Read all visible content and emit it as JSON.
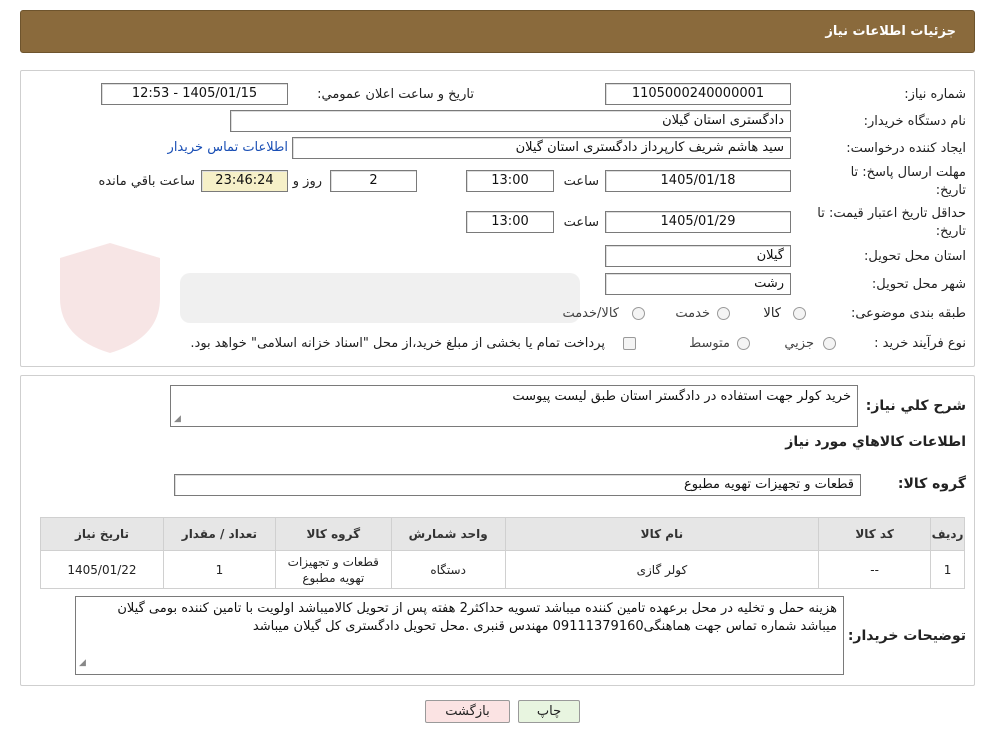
{
  "header": {
    "title": "جزئیات اطلاعات نیاز"
  },
  "form": {
    "need_number_label": "شماره نیاز:",
    "need_number": "1105000240000001",
    "announce_label": "تاریخ و ساعت اعلان عمومي:",
    "announce_value": "1405/01/15 - 12:53",
    "buyer_org_label": "نام دستگاه خريدار:",
    "buyer_org": "دادگستری استان گیلان",
    "creator_label": "ايجاد کننده درخواست:",
    "creator": "سید هاشم شریف کارپرداز دادگستری استان گیلان",
    "contact_link": "اطلاعات تماس خريدار",
    "deadline_label_1": "مهلت ارسال پاسخ: تا",
    "deadline_label_2": "تاريخ:",
    "deadline_date": "1405/01/18",
    "time_label": "ساعت",
    "deadline_time": "13:00",
    "days_value": "2",
    "days_label": "روز و",
    "remaining_time": "23:46:24",
    "remaining_label": "ساعت باقي مانده",
    "validity_label_1": "حداقل تاريخ اعتبار قيمت: تا",
    "validity_label_2": "تاريخ:",
    "validity_date": "1405/01/29",
    "validity_time": "13:00",
    "province_label": "استان محل تحويل:",
    "province": "گیلان",
    "city_label": "شهر محل تحويل:",
    "city": "رشت",
    "category_label": "طبقه بندی موضوعی:",
    "category_options": [
      "کالا",
      "خدمت",
      "کالا/خدمت"
    ],
    "process_label": "نوع فرآيند خريد :",
    "process_options": [
      "جزيي",
      "متوسط"
    ],
    "payment_note": "پرداخت تمام يا بخشی از مبلغ خريد،از محل \"اسناد خزانه اسلامی\" خواهد بود."
  },
  "details": {
    "summary_label": "شرح کلي نياز:",
    "summary": "خرید کولر جهت استفاده در دادگستر استان طبق لیست پیوست",
    "goods_info_title": "اطلاعات کالاهاي مورد نياز",
    "goods_group_label": "گروه کالا:",
    "goods_group": "قطعات و تجهیزات تهویه مطبوع",
    "table": {
      "headers": [
        "رديف",
        "کد کالا",
        "نام کالا",
        "واحد شمارش",
        "گروه کالا",
        "تعداد / مقدار",
        "تاريخ نياز"
      ],
      "rows": [
        [
          "1",
          "--",
          "کولر گازی",
          "دستگاه",
          "قطعات و تجهیزات\nتهویه مطبوع",
          "1",
          "1405/01/22"
        ]
      ]
    },
    "buyer_notes_label": "توضيحات خريدار:",
    "buyer_notes": "هزینه حمل و تخلیه در محل برعهده تامین کننده میباشد تسویه حداکثر2 هفته پس از تحویل کالامیباشد اولویت با تامین کننده بومی گیلان میباشد شماره تماس جهت هماهنگی09111379160 مهندس قنبری .محل تحویل دادگستری  کل گیلان میباشد"
  },
  "buttons": {
    "print": "چاپ",
    "back": "بازگشت"
  },
  "colors": {
    "header_bg": "#8a6a3c",
    "remaining_bg": "#f6f0c8",
    "print_bg": "#e8f5e0",
    "back_bg": "#fbe3e3"
  }
}
